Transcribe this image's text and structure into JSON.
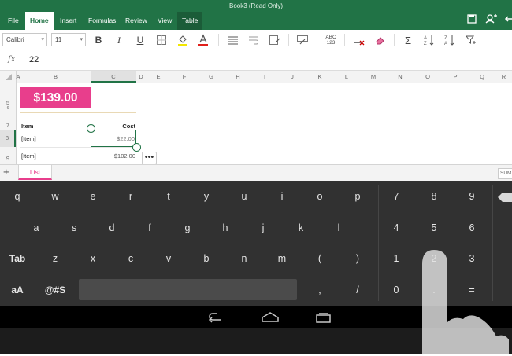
{
  "window": {
    "title": "Book3 (Read Only)"
  },
  "ribbon_tabs": [
    "File",
    "Home",
    "Insert",
    "Formulas",
    "Review",
    "View",
    "Table"
  ],
  "titlebar_icons": [
    "save-icon",
    "share-icon",
    "undo-icon"
  ],
  "font": {
    "name": "Calibri",
    "size": "11"
  },
  "ribbon_icons": [
    "bold-icon",
    "italic-icon",
    "underline-icon",
    "borders-icon",
    "fill-color-icon",
    "font-color-icon",
    "align-icon",
    "wrap-text-icon",
    "merge-cells-icon",
    "cell-styles-icon",
    "number-format-icon",
    "insert-delete-icon",
    "clear-icon",
    "sum-icon",
    "sort-ascending-icon",
    "sort-descending-icon",
    "filter-icon"
  ],
  "ribbon_labels": {
    "bold": "B",
    "italic": "I",
    "underline": "U",
    "number_format": "ABC\n123",
    "sum": "Σ"
  },
  "formula_bar": {
    "fx": "fx",
    "value": "22"
  },
  "columns": [
    "A",
    "B",
    "C",
    "D",
    "E",
    "F",
    "G",
    "H",
    "I",
    "J",
    "K",
    "L",
    "M",
    "N",
    "O",
    "P",
    "Q",
    "R"
  ],
  "rows": [
    "5",
    "6",
    "7",
    "8",
    "9"
  ],
  "sheet": {
    "price": "$139.00",
    "header_item": "Item",
    "header_cost": "Cost",
    "row8_item": "[Item]",
    "row8_cost": "$22.00",
    "row9_item": "[Item]",
    "row9_cost": "$102.00"
  },
  "more_button": "•••",
  "sheet_tabs": {
    "add": "+",
    "active": "List",
    "status": "SUM"
  },
  "keyboard": {
    "row1": [
      "q",
      "w",
      "e",
      "r",
      "t",
      "y",
      "u",
      "i",
      "o",
      "p"
    ],
    "row2": [
      "a",
      "s",
      "d",
      "f",
      "g",
      "h",
      "j",
      "k",
      "l"
    ],
    "row3": [
      "Tab",
      "z",
      "x",
      "c",
      "v",
      "b",
      "n",
      "m",
      "(",
      ")"
    ],
    "row4_left": [
      "aA",
      "@#S"
    ],
    "row4_right": [
      ",",
      "/"
    ],
    "num1": [
      "7",
      "8",
      "9"
    ],
    "num2": [
      "4",
      "5",
      "6"
    ],
    "num3": [
      "1",
      "2",
      "3"
    ],
    "num4": [
      "0",
      ".",
      "="
    ]
  },
  "navbar_icons": [
    "back-icon",
    "home-icon",
    "recents-icon"
  ],
  "colors": {
    "excel_green": "#217346",
    "accent_pink": "#e83e8c",
    "keyboard_bg": "#313131"
  }
}
